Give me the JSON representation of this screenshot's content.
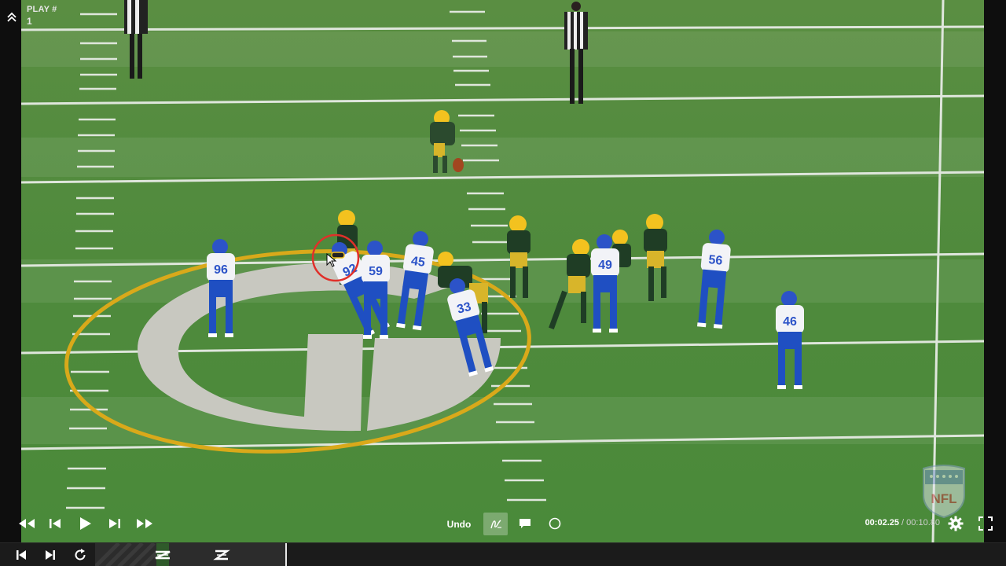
{
  "header": {
    "play_label": "PLAY #",
    "play_number": "1"
  },
  "field": {
    "grass_color": "#4e8a3e",
    "line_color": "#dfe6dc",
    "logo_color": "#c8c8c0",
    "logo_ring_color": "#d9a91a"
  },
  "teams": {
    "rams_jersey": "#f2f3f7",
    "rams_pants": "#1f4fc2",
    "packers_jersey": "#1f3d25",
    "packers_pants": "#d8b52a"
  },
  "rams_numbers": [
    "96",
    "92",
    "59",
    "45",
    "33",
    "49",
    "56",
    "46"
  ],
  "controls": {
    "undo_label": "Undo",
    "current_time": "00:02.25",
    "separator": " / ",
    "total_time": "00:10.80"
  },
  "watermark": "NFL",
  "icons": {
    "collapse": "chevron-double-up-icon",
    "rewind": "rewind-icon",
    "step_back": "step-back-icon",
    "play": "play-icon",
    "step_forward": "step-forward-icon",
    "fast_forward": "fast-forward-icon",
    "draw": "freehand-draw-icon",
    "comment": "comment-icon",
    "circle": "circle-tool-icon",
    "settings": "gear-icon",
    "fullscreen": "fullscreen-icon",
    "skip_start": "skip-to-start-icon",
    "skip_end": "skip-to-end-icon",
    "replay": "replay-icon"
  }
}
